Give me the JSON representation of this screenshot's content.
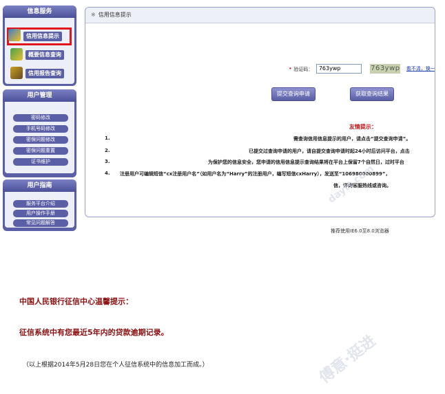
{
  "sidebar": {
    "info_service": {
      "title": "信息服务",
      "items": [
        {
          "label": "信用信息提示",
          "icon": "credit-info-icon",
          "selected": true
        },
        {
          "label": "概要信息查询",
          "icon": "summary-query-icon",
          "selected": false
        },
        {
          "label": "信用报告查询",
          "icon": "report-query-icon",
          "selected": false
        }
      ]
    },
    "user_manage": {
      "title": "用户管理",
      "items": [
        "密码修改",
        "手机号码修改",
        "密保问题修改",
        "密保问题重置",
        "证书维护"
      ]
    },
    "user_guide": {
      "title": "用户指南",
      "items": [
        "服务平台介绍",
        "用户操作手册",
        "常见问题解答"
      ]
    }
  },
  "panel": {
    "title": "信用信息提示",
    "captcha_label": "验证码：",
    "captcha_value": "763ywp",
    "captcha_image_text": "763ywp",
    "captcha_refresh": "看不清，换一个",
    "submit_button": "提交查询申请",
    "fetch_button": "获取查询结果",
    "tips_title": "友情提示：",
    "tips": [
      {
        "n": "1.",
        "text": "需查询信用信息提示的用户，请点击“提交查询申请”。"
      },
      {
        "n": "2.",
        "text": "已提交过查询申请的用户，请自提交查询申请时起24小时后访问平台，点击"
      },
      {
        "n": "3.",
        "text": "为保护您的信息安全，您申请的信用信息提示查询结果将在平台上保留7个自然日，过时平台"
      },
      {
        "n": "4.",
        "text": "注册用户可编辑短信“cx注册用户名”（如用户名为“Harry”的注册用户，编写短信cxHarry），发送至“106980000899”，"
      },
      {
        "n": "",
        "text": "信，详询客服热线或咨询。"
      }
    ],
    "browser_note": "推荐使用IE6.0至8.0浏览器"
  },
  "notice": {
    "title": "中国人民银行征信中心温馨提示：",
    "body": "征信系统中有您最近5年内的贷款逾期记录。",
    "foot": "（以上根据2014年5月28日您在个人征信系统中的信息加工而成。）"
  },
  "watermark": {
    "text": "傅意·挺进",
    "site": "daytt.com"
  },
  "colors": {
    "nav": "#5a5fa6",
    "highlight": "#e0141a",
    "notice": "#8a1010"
  }
}
